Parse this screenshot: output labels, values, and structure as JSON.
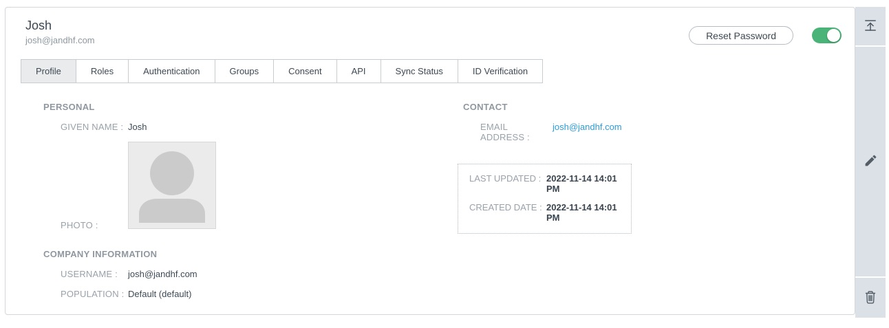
{
  "header": {
    "name": "Josh",
    "email": "josh@jandhf.com",
    "reset_password_button": "Reset Password",
    "enabled_toggle_state": "on"
  },
  "tabs": {
    "active": "Profile",
    "items": [
      "Profile",
      "Roles",
      "Authentication",
      "Groups",
      "Consent",
      "API",
      "Sync Status",
      "ID Verification"
    ]
  },
  "sections": {
    "personal": {
      "title": "PERSONAL",
      "fields": [
        {
          "label": "GIVEN NAME :",
          "value": "Josh"
        },
        {
          "label": "PHOTO :",
          "value": ""
        }
      ]
    },
    "company": {
      "title": "COMPANY INFORMATION",
      "fields": [
        {
          "label": "USERNAME :",
          "value": "josh@jandhf.com"
        },
        {
          "label": "POPULATION :",
          "value": "Default (default)"
        }
      ]
    },
    "contact": {
      "title": "CONTACT",
      "fields": [
        {
          "label": "EMAIL ADDRESS :",
          "value": "josh@jandhf.com"
        }
      ]
    },
    "audit": {
      "fields": [
        {
          "label": "LAST UPDATED :",
          "value": "2022-11-14 14:01 PM"
        },
        {
          "label": "CREATED DATE :",
          "value": "2022-11-14 14:01 PM"
        }
      ]
    }
  },
  "toolbar": {
    "icons": [
      "collapse-panel-icon",
      "edit-pencil-icon",
      "delete-trash-icon"
    ]
  },
  "colors": {
    "toggle_on_green": "#4ab377",
    "email_link_blue": "#2d9cd8",
    "toolbar_bg": "#dce1e7",
    "active_tab_bg": "#e9ebed"
  }
}
